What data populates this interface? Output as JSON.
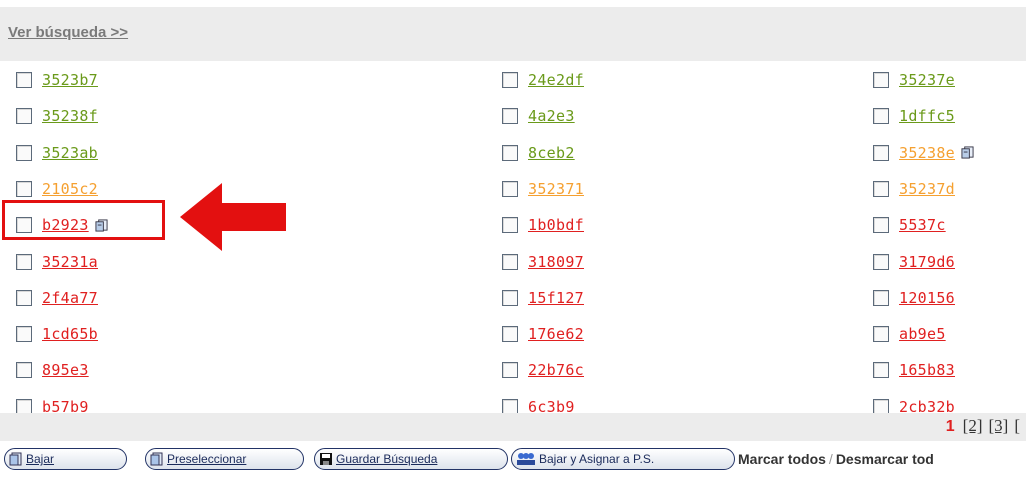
{
  "header": {
    "link_label": "Ver búsqueda >>"
  },
  "columns": [
    {
      "items": [
        {
          "code": "3523b7",
          "status": "green",
          "icon": ""
        },
        {
          "code": "35238f",
          "status": "green",
          "icon": ""
        },
        {
          "code": "3523ab",
          "status": "green",
          "icon": ""
        },
        {
          "code": "2105c2",
          "status": "orange",
          "icon": ""
        },
        {
          "code": "b2923",
          "status": "red",
          "icon": "document-icon"
        },
        {
          "code": "35231a",
          "status": "red",
          "icon": ""
        },
        {
          "code": "2f4a77",
          "status": "red",
          "icon": ""
        },
        {
          "code": "1cd65b",
          "status": "red",
          "icon": ""
        },
        {
          "code": "895e3",
          "status": "red",
          "icon": ""
        },
        {
          "code": "b57b9",
          "status": "red",
          "icon": ""
        }
      ]
    },
    {
      "items": [
        {
          "code": "24e2df",
          "status": "green",
          "icon": ""
        },
        {
          "code": "4a2e3",
          "status": "green",
          "icon": ""
        },
        {
          "code": "8ceb2",
          "status": "green",
          "icon": ""
        },
        {
          "code": "352371",
          "status": "orange",
          "icon": ""
        },
        {
          "code": "1b0bdf",
          "status": "red",
          "icon": ""
        },
        {
          "code": "318097",
          "status": "red",
          "icon": ""
        },
        {
          "code": "15f127",
          "status": "red",
          "icon": ""
        },
        {
          "code": "176e62",
          "status": "red",
          "icon": ""
        },
        {
          "code": "22b76c",
          "status": "red",
          "icon": ""
        },
        {
          "code": "6c3b9",
          "status": "red",
          "icon": ""
        }
      ]
    },
    {
      "items": [
        {
          "code": "35237e",
          "status": "green",
          "icon": ""
        },
        {
          "code": "1dffc5",
          "status": "green",
          "icon": ""
        },
        {
          "code": "35238e",
          "status": "orange",
          "icon": "document-icon"
        },
        {
          "code": "35237d",
          "status": "orange",
          "icon": ""
        },
        {
          "code": "5537c",
          "status": "red",
          "icon": ""
        },
        {
          "code": "3179d6",
          "status": "red",
          "icon": ""
        },
        {
          "code": "120156",
          "status": "red",
          "icon": ""
        },
        {
          "code": "ab9e5",
          "status": "red",
          "icon": ""
        },
        {
          "code": "165b83",
          "status": "red",
          "icon": ""
        },
        {
          "code": "2cb32b",
          "status": "red",
          "icon": ""
        }
      ]
    }
  ],
  "colors": {
    "green": "#6a9a1a",
    "orange": "#f5a030",
    "red": "#e02020",
    "highlight": "#e31010"
  },
  "pagination": {
    "current": "1",
    "pages": [
      "[2]",
      "[3]",
      "["
    ]
  },
  "actions": {
    "bajar": "Bajar",
    "preseleccionar": "Preseleccionar",
    "guardar": "Guardar Búsqueda",
    "bajar_asignar": "Bajar y Asignar a P.S.",
    "marcar_todos": "Marcar todos",
    "separator": "/",
    "desmarcar_todos": "Desmarcar tod"
  }
}
